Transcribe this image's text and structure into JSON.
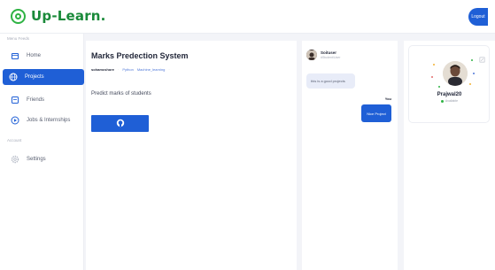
{
  "app": {
    "logo_text": "Up-Learn.",
    "logout_label": "Logout",
    "brand_color": "#1a8a3a",
    "accent_color": "#1f5fd6"
  },
  "sidebar": {
    "menu_label": "Menu Feeds",
    "account_label": "Account",
    "items": [
      {
        "label": "Home",
        "icon": "home-icon",
        "active": false
      },
      {
        "label": "Projects",
        "icon": "globe-icon",
        "active": true
      },
      {
        "label": "Friends",
        "icon": "friends-icon",
        "active": false
      },
      {
        "label": "Jobs & Internships",
        "icon": "play-circle-icon",
        "active": false
      }
    ],
    "settings_label": "Settings"
  },
  "project": {
    "title": "Marks Predection System",
    "owner": "sohamcshore",
    "tags": [
      "Python",
      "Machine_learning"
    ],
    "description": "Predict marks of students",
    "github_icon": "github-icon"
  },
  "chat": {
    "user_name": "Soituser",
    "user_sub": "#Student/User",
    "incoming_message": "this is a good projects",
    "you_label": "You",
    "outgoing_message": "Nice Project"
  },
  "profile": {
    "name": "Prajwal20",
    "status": "Available"
  }
}
